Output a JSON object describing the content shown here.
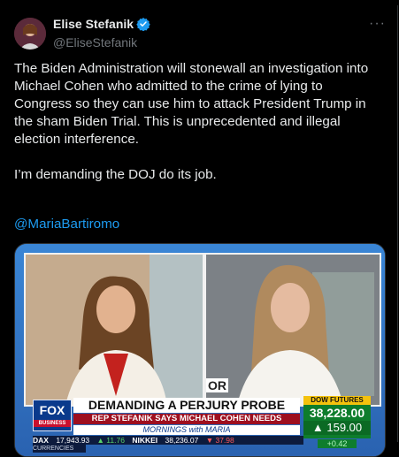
{
  "author": {
    "display_name": "Elise Stefanik",
    "handle": "@EliseStefanik",
    "verified": true,
    "verified_color": "#1d9bf0"
  },
  "more_menu": "···",
  "tweet": {
    "paragraph1": "The Biden Administration will stonewall an investigation into Michael Cohen who admitted to the crime of lying to Congress so they can use him to attack President Trump in the sham Biden Trial. This is unprecedented and illegal election interference.",
    "paragraph2": "I’m demanding the DOJ do its job.",
    "mention": "@MariaBartiromo",
    "mention_color": "#1d9bf0"
  },
  "media": {
    "network_logo": "FOX",
    "network_sub": "BUSINESS",
    "headline": "DEMANDING A PERJURY PROBE",
    "subhead": "REP STEFANIK SAYS MICHAEL COHEN NEEDS INVESTIGATING",
    "show_name": "MORNINGS with MARIA",
    "dow_label": "DOW FUTURES",
    "dow_value": "38,228.00",
    "dow_change": "▲ 159.00",
    "dow_pct": "+0.42",
    "crawl": [
      {
        "name": "DAX",
        "value": "17,943.93",
        "change": "▲ 11.76",
        "dir": "up"
      },
      {
        "name": "NIKKEI",
        "value": "38,236.07",
        "change": "▼ 37.98",
        "dir": "down"
      }
    ],
    "currencies_label": "CURRENCIES",
    "screen_text": "OR"
  }
}
